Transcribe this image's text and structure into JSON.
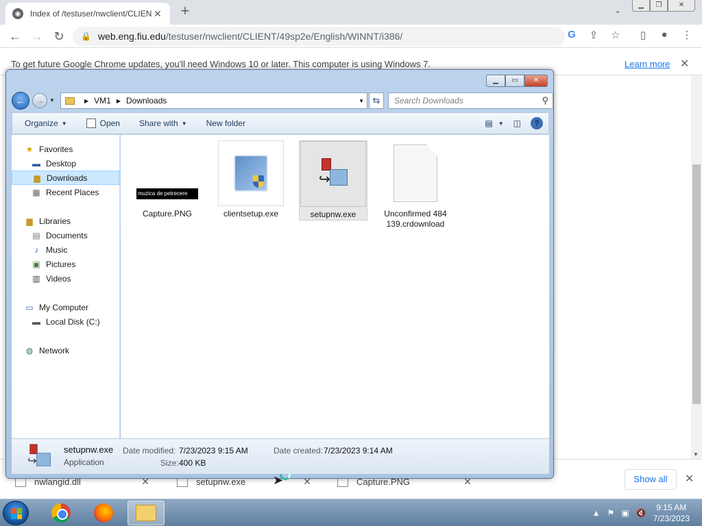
{
  "chrome": {
    "tab_title": "Index of /testuser/nwclient/CLIENT",
    "tab_close": "✕",
    "new_tab": "+",
    "url_domain": "web.eng.fiu.edu",
    "url_path": "/testuser/nwclient/CLIENT/49sp2e/English/WINNT/i386/"
  },
  "infobar": {
    "message": "To get future Google Chrome updates, you'll need Windows 10 or later. This computer is using Windows 7.",
    "learn_more": "Learn more"
  },
  "explorer": {
    "breadcrumb": [
      "VM1",
      "Downloads"
    ],
    "search_placeholder": "Search Downloads",
    "commands": {
      "organize": "Organize",
      "open": "Open",
      "share_with": "Share with",
      "new_folder": "New folder"
    },
    "nav": {
      "favorites": "Favorites",
      "desktop": "Desktop",
      "downloads": "Downloads",
      "recent_places": "Recent Places",
      "libraries": "Libraries",
      "documents": "Documents",
      "music": "Music",
      "pictures": "Pictures",
      "videos": "Videos",
      "my_computer": "My Computer",
      "local_disk": "Local Disk (C:)",
      "network": "Network"
    },
    "files": [
      {
        "name": "Capture.PNG",
        "thumb_text": "muzica de petrecere"
      },
      {
        "name": "clientsetup.exe"
      },
      {
        "name": "setupnw.exe"
      },
      {
        "name": "Unconfirmed 484139.crdownload"
      }
    ],
    "details": {
      "name": "setupnw.exe",
      "type": "Application",
      "date_modified_label": "Date modified:",
      "date_modified": "7/23/2023 9:15 AM",
      "date_created_label": "Date created:",
      "date_created": "7/23/2023 9:14 AM",
      "size_label": "Size:",
      "size": "400 KB"
    }
  },
  "shelf": {
    "items": [
      "nwlangid.dll",
      "setupnw.exe",
      "Capture.PNG"
    ],
    "show_all": "Show all"
  },
  "taskbar": {
    "time": "9:15 AM",
    "date": "7/23/2023"
  }
}
